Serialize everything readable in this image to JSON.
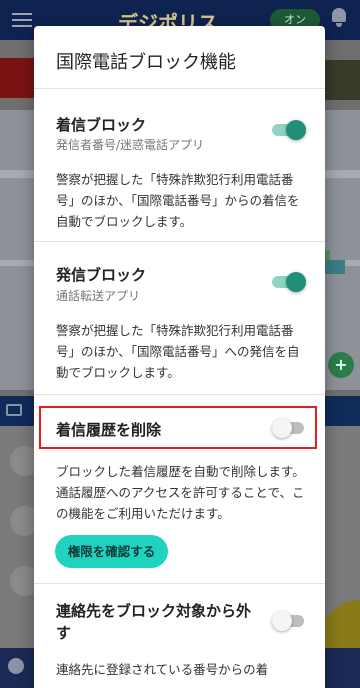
{
  "background": {
    "app_title": "デジポリス",
    "on_button": "オン"
  },
  "dialog": {
    "title": "国際電話ブロック機能",
    "incoming": {
      "title": "着信ブロック",
      "subtitle": "発信者番号/迷惑電話アプリ",
      "enabled": true,
      "description": "警察が把握した「特殊詐欺犯行利用電話番号」のほか、「国際電話番号」からの着信を自動でブロックします。"
    },
    "outgoing": {
      "title": "発信ブロック",
      "subtitle": "通話転送アプリ",
      "enabled": true,
      "description": "警察が把握した「特殊詐欺犯行利用電話番号」のほか、「国際電話番号」への発信を自動でブロックします。"
    },
    "delete_history": {
      "title": "着信履歴を削除",
      "enabled": false,
      "description": "ブロックした着信履歴を自動で削除します。通話履歴へのアクセスを許可することで、この機能をご利用いただけます。",
      "button_label": "権限を確認する"
    },
    "exclude_contacts": {
      "title": "連絡先をブロック対象から外す",
      "enabled": false,
      "description": "連絡先に登録されている番号からの着"
    }
  },
  "colors": {
    "toggle_on": "#1f8f7a",
    "toggle_on_track": "#8fd3c3",
    "permission_button": "#1fd3be",
    "highlight_border": "#e02020"
  }
}
